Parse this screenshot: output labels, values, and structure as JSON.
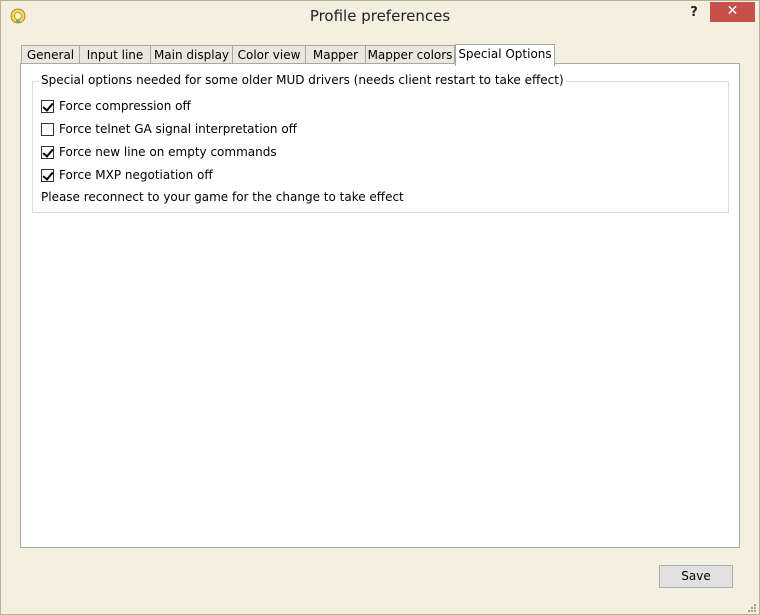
{
  "window": {
    "title": "Profile preferences",
    "help_label": "?",
    "close_label": "✕"
  },
  "tabs": [
    {
      "label": "General"
    },
    {
      "label": "Input line"
    },
    {
      "label": "Main display"
    },
    {
      "label": "Color view"
    },
    {
      "label": "Mapper"
    },
    {
      "label": "Mapper colors"
    },
    {
      "label": "Special Options",
      "active": true
    }
  ],
  "special_options": {
    "group_title": "Special options needed for some older MUD drivers (needs client restart to take effect)",
    "options": [
      {
        "label": "Force compression off",
        "checked": true
      },
      {
        "label": "Force telnet GA signal interpretation off",
        "checked": false
      },
      {
        "label": "Force new line on empty commands",
        "checked": true
      },
      {
        "label": "Force MXP negotiation off",
        "checked": true
      }
    ],
    "note": "Please reconnect to your game for the change to take effect"
  },
  "footer": {
    "save_label": "Save"
  },
  "colors": {
    "close_button": "#c7504c",
    "window_background": "#f4f0e1"
  }
}
